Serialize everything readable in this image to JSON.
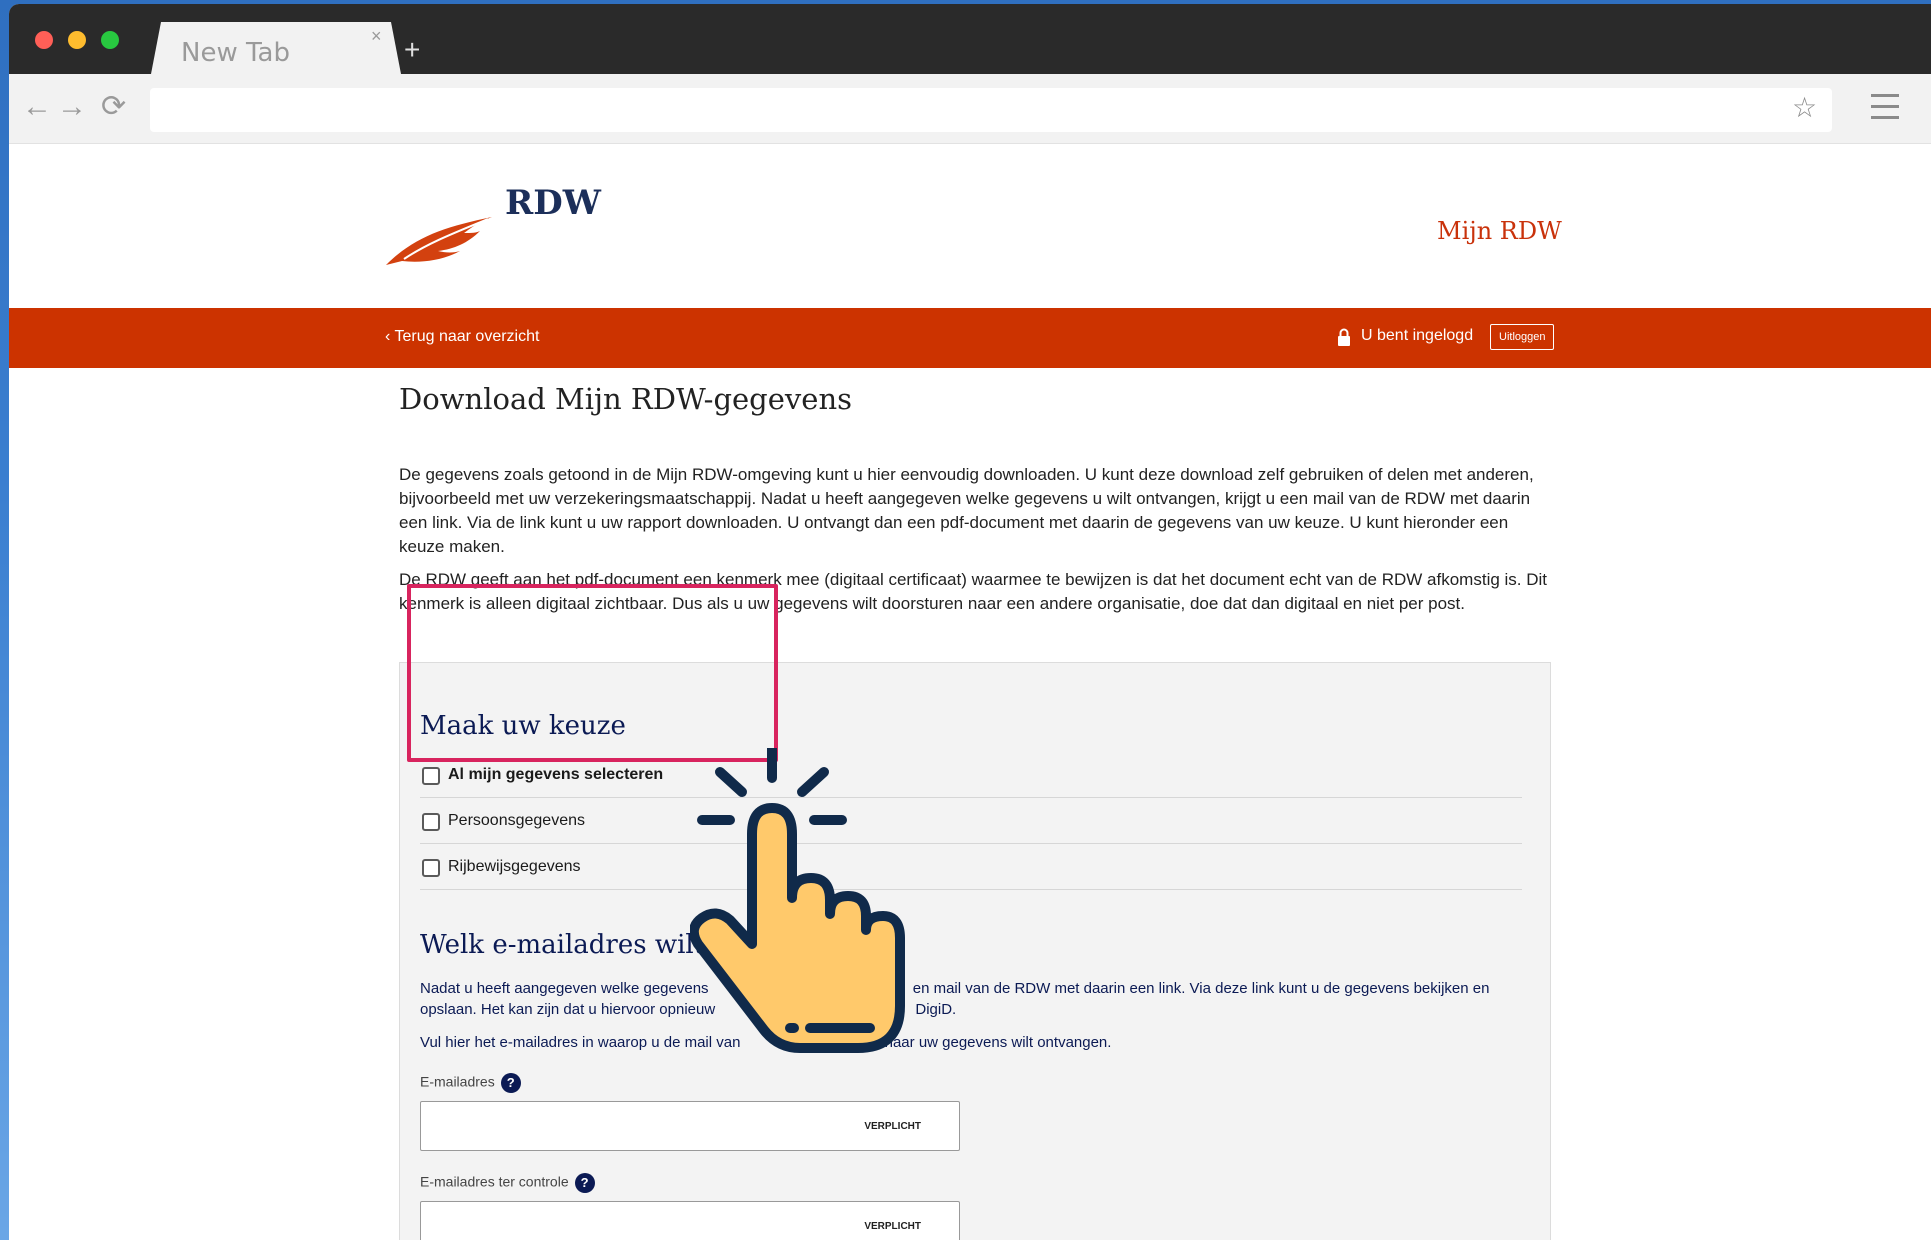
{
  "browser": {
    "tab_title": "New Tab",
    "tab_close": "×",
    "new_tab": "+",
    "url": "",
    "back": "←",
    "forward": "→",
    "reload": "⟳",
    "star": "☆"
  },
  "header": {
    "logo_text": "RDW",
    "mijn_rdw": "Mijn RDW"
  },
  "bar": {
    "back_link": "Terug naar overzicht",
    "logged_in": "U bent ingelogd",
    "logout": "Uitloggen"
  },
  "main": {
    "title": "Download Mijn RDW-gegevens",
    "intro_1": "De gegevens zoals getoond in de Mijn RDW-omgeving kunt u hier eenvoudig downloaden. U kunt deze download zelf gebruiken of delen met anderen, bijvoorbeeld met uw verzekeringsmaatschappij. Nadat u heeft aangegeven welke gegevens u wilt ontvangen, krijgt u een mail van de RDW met daarin een link. Via de link kunt u uw rapport downloaden. U ontvangt dan een pdf-document met daarin de gegevens van uw keuze. U kunt hieronder een keuze maken.",
    "intro_2": "De RDW geeft aan het pdf-document een kenmerk mee (digitaal certificaat) waarmee te bewijzen is dat het document echt van de RDW afkomstig is. Dit kenmerk is alleen digitaal zichtbaar. Dus als u uw gegevens wilt doorsturen naar een andere organisatie, doe dat dan digitaal en niet per post."
  },
  "choice": {
    "heading": "Maak uw keuze",
    "options": [
      {
        "label": "Al mijn gegevens selecteren",
        "checked": false
      },
      {
        "label": "Persoonsgegevens",
        "checked": false
      },
      {
        "label": "Rijbewijsgegevens",
        "checked": false
      }
    ]
  },
  "email": {
    "heading": "Welk e-mailadres wilt",
    "text_1": "Nadat u heeft aangegeven welke gegevens",
    "text_1b": "en mail van de RDW met daarin een link. Via deze link kunt u de gegevens bekijken en",
    "text_1c": "opslaan. Het kan zijn dat u hiervoor opnieuw",
    "text_1d": "DigiD.",
    "text_2a": "Vul hier het e-mailadres in waarop u de mail van",
    "text_2b": "naar uw gegevens wilt ontvangen.",
    "label_1": "E-mailadres",
    "label_2": "E-mailadres ter controle",
    "help": "?",
    "required": "VERPLICHT",
    "value_1": "",
    "value_2": ""
  },
  "colors": {
    "brand_orange": "#cc3300",
    "navy": "#0b1a54",
    "highlight": "#d8245e",
    "hand_fill": "#ffc96b"
  }
}
